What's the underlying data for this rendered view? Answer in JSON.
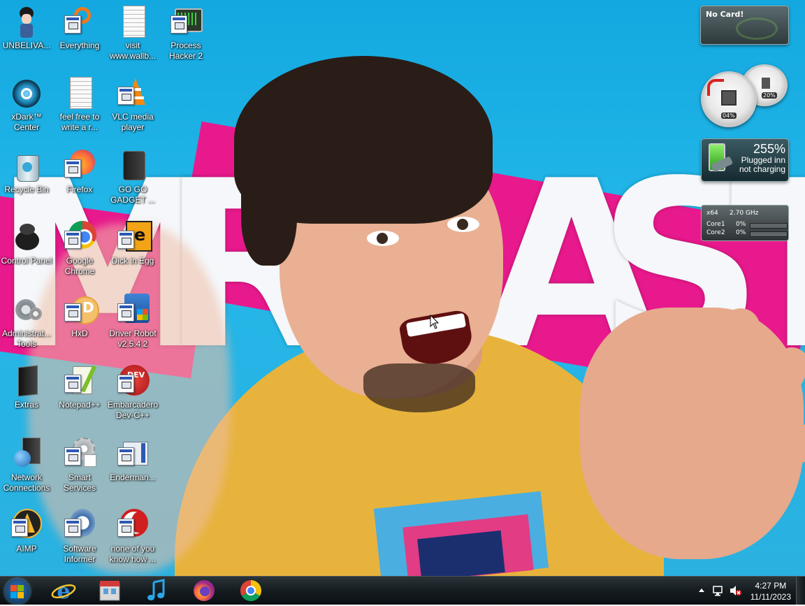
{
  "desktop": {
    "wallpaper_text": "MRBEAST",
    "icons": [
      {
        "label": "UNBELIVA...",
        "icon": "anime-character-icon"
      },
      {
        "label": "Everything",
        "icon": "everything-search-icon"
      },
      {
        "label": "visit www.wallb...",
        "icon": "text-document-icon"
      },
      {
        "label": "Process Hacker 2",
        "icon": "process-hacker-icon"
      },
      {
        "label": "xDark™ Center",
        "icon": "xdark-icon"
      },
      {
        "label": "feel free to write a r...",
        "icon": "text-document-icon"
      },
      {
        "label": "VLC media player",
        "icon": "vlc-cone-icon"
      },
      {
        "label": "Recycle Bin",
        "icon": "recycle-bin-icon"
      },
      {
        "label": "Firefox",
        "icon": "firefox-icon"
      },
      {
        "label": "GO GO GADGET ...",
        "icon": "wallet-icon"
      },
      {
        "label": "Control Panel",
        "icon": "control-panel-icon"
      },
      {
        "label": "Google Chrome",
        "icon": "chrome-icon"
      },
      {
        "label": "Dick in Egg",
        "icon": "de-app-icon"
      },
      {
        "label": "Administrat... Tools",
        "icon": "admin-tools-icon"
      },
      {
        "label": "HxD",
        "icon": "hxd-icon"
      },
      {
        "label": "Driver Robot v2.5.4.2",
        "icon": "driver-robot-icon"
      },
      {
        "label": "Extras",
        "icon": "folder-dark-icon"
      },
      {
        "label": "Notepad++",
        "icon": "notepad-plus-icon"
      },
      {
        "label": "Embarcadero Dev-C++",
        "icon": "devcpp-icon"
      },
      {
        "label": "Network Connections",
        "icon": "network-icon"
      },
      {
        "label": "Smart Services",
        "icon": "gears-icon"
      },
      {
        "label": "Enderman...",
        "icon": "window-icon"
      },
      {
        "label": "AIMP",
        "icon": "aimp-icon"
      },
      {
        "label": "Software Informer",
        "icon": "software-informer-icon"
      },
      {
        "label": "none of you know how ...",
        "icon": "red-circle-icon"
      }
    ]
  },
  "gadgets": {
    "gpu": {
      "text": "No Card!"
    },
    "meters": {
      "cpu_value": "04%",
      "memory_value": "20%"
    },
    "battery": {
      "percent": "255%",
      "line1": "Plugged inn",
      "line2": "not charging"
    },
    "cpu": {
      "arch": "x64",
      "clock": "2.70 GHz",
      "cores": [
        {
          "name": "Core1",
          "pct": "0%",
          "fill": 0
        },
        {
          "name": "Core2",
          "pct": "0%",
          "fill": 0
        }
      ]
    }
  },
  "taskbar": {
    "pinned": [
      {
        "name": "internet-explorer-icon"
      },
      {
        "name": "store-icon"
      },
      {
        "name": "music-icon"
      },
      {
        "name": "firefox-icon"
      },
      {
        "name": "chrome-icon"
      }
    ],
    "clock": {
      "time": "4:27 PM",
      "date": "11/11/2023"
    }
  },
  "colors": {
    "wallpaper_blue": "#13a8df",
    "wallpaper_pink": "#e8198c",
    "shirt_yellow": "#e7b33c",
    "taskbar": "#151c20"
  }
}
